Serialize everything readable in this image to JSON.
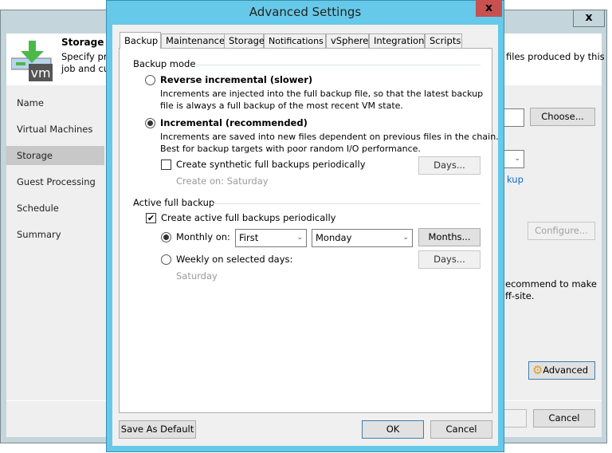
{
  "background_window": {
    "header_title": "Storage",
    "header_desc_line1": "Specify pr",
    "header_desc_line2": "job and cu",
    "header_desc_right": "files produced by this",
    "nav": [
      "Name",
      "Virtual Machines",
      "Storage",
      "Guest Processing",
      "Schedule",
      "Summary"
    ],
    "selected_nav": "Storage",
    "choose_label": "Choose...",
    "link_fragment": "kup",
    "configure_label": "Configure...",
    "note_line1": "ecommend to make",
    "note_line2": "ff-site.",
    "advanced_label": "Advanced",
    "cancel_label": "Cancel",
    "close_glyph": "x",
    "logo_text": "vm"
  },
  "dialog": {
    "title": "Advanced Settings",
    "close_glyph": "x",
    "tabs": [
      "Backup",
      "Maintenance",
      "Storage",
      "Notifications",
      "vSphere",
      "Integration",
      "Scripts"
    ],
    "active_tab": "Backup",
    "backup_mode": {
      "label": "Backup mode",
      "reverse_label": "Reverse incremental (slower)",
      "reverse_desc1": "Increments are injected into the full backup file, so that the latest backup",
      "reverse_desc2": "file is always a full backup of the most recent VM state.",
      "incremental_label": "Incremental (recommended)",
      "incremental_desc1": "Increments are saved into new files dependent on previous files in the chain.",
      "incremental_desc2": "Best for backup targets with poor random I/O performance.",
      "synthetic_label": "Create synthetic full backups periodically",
      "synthetic_checked": false,
      "days_label": "Days...",
      "create_on": "Create on:  Saturday"
    },
    "active_full": {
      "label": "Active full backup",
      "create_label": "Create active full backups periodically",
      "create_checked": true,
      "monthly_label": "Monthly on:",
      "monthly_week": "First",
      "monthly_day": "Monday",
      "months_label": "Months...",
      "weekly_label": "Weekly on selected days:",
      "weekly_days_label": "Days...",
      "weekly_value": "Saturday"
    },
    "save_default_label": "Save As Default",
    "ok_label": "OK",
    "cancel_label": "Cancel"
  }
}
